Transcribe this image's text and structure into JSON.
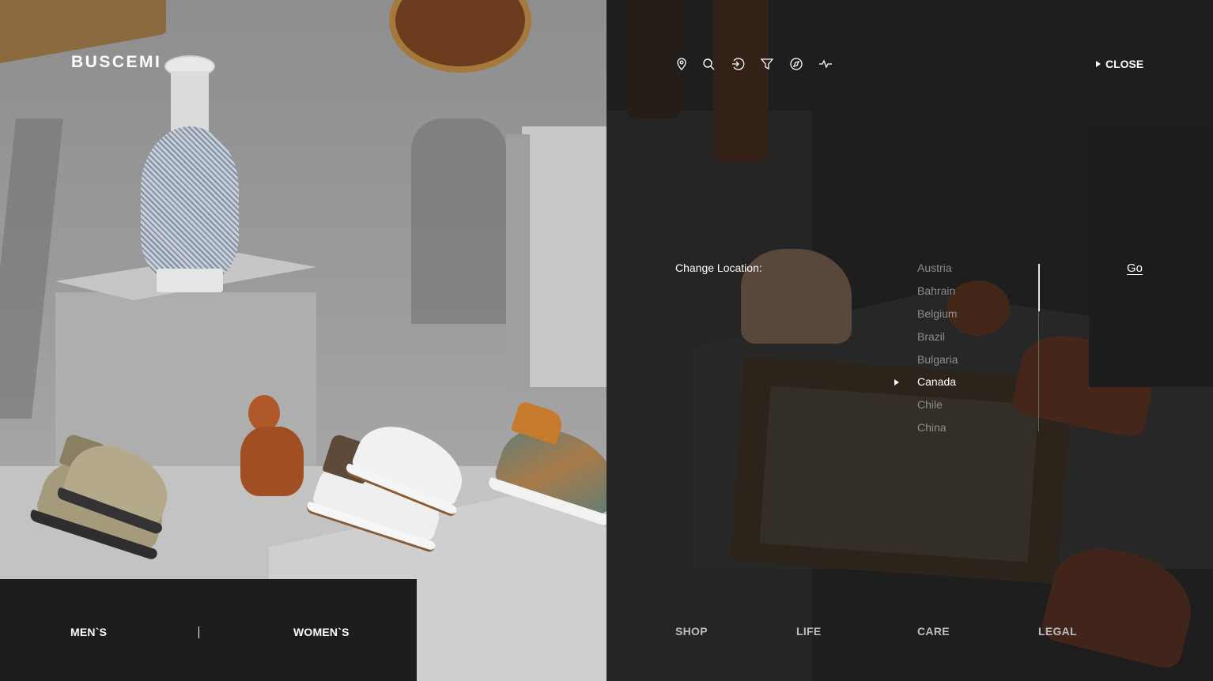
{
  "brand": {
    "logo_text": "BUSCEMI"
  },
  "left_nav": {
    "mens_label": "MEN`S",
    "womens_label": "WOMEN`S"
  },
  "toolbar": {
    "icons": [
      "location-pin-icon",
      "search-icon",
      "login-icon",
      "filter-icon",
      "compass-icon",
      "activity-icon"
    ],
    "close_label": "CLOSE"
  },
  "location_panel": {
    "label": "Change Location:",
    "countries": [
      "Austria",
      "Bahrain",
      "Belgium",
      "Brazil",
      "Bulgaria",
      "Canada",
      "Chile",
      "China"
    ],
    "selected": "Canada",
    "go_label": "Go"
  },
  "footer_nav": {
    "shop": "SHOP",
    "life": "LIFE",
    "care": "CARE",
    "legal": "LEGAL"
  },
  "colors": {
    "text_primary": "#ffffff",
    "text_muted": "#8d8d8d",
    "panel_dark": "#1d1d1d"
  }
}
